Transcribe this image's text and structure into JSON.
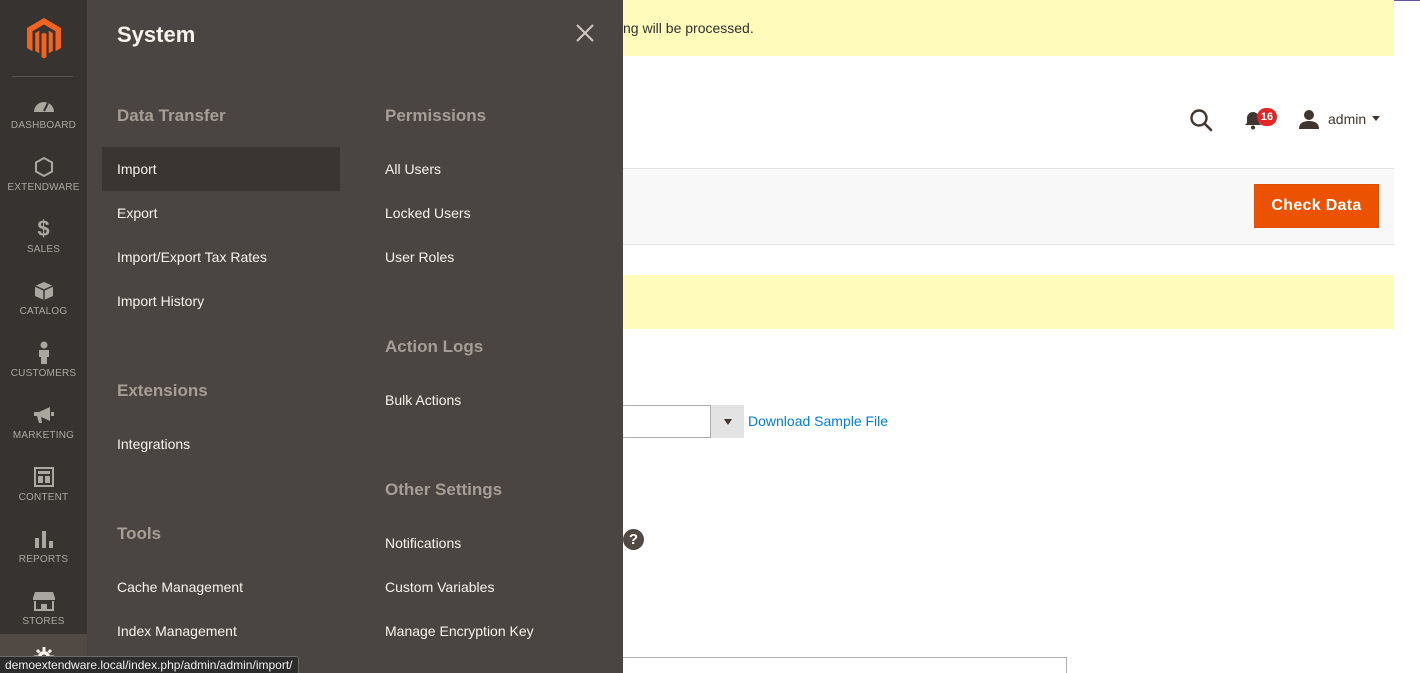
{
  "sidebar": {
    "logo": "magento-logo",
    "items": [
      {
        "label": "DASHBOARD",
        "icon": "dashboard-icon"
      },
      {
        "label": "EXTENDWARE",
        "icon": "hexagon-icon"
      },
      {
        "label": "SALES",
        "icon": "dollar-icon"
      },
      {
        "label": "CATALOG",
        "icon": "box-icon"
      },
      {
        "label": "CUSTOMERS",
        "icon": "person-icon"
      },
      {
        "label": "MARKETING",
        "icon": "megaphone-icon"
      },
      {
        "label": "CONTENT",
        "icon": "layout-icon"
      },
      {
        "label": "REPORTS",
        "icon": "bar-chart-icon"
      },
      {
        "label": "STORES",
        "icon": "storefront-icon"
      },
      {
        "label": "",
        "icon": "gear-icon"
      }
    ]
  },
  "page": {
    "message_top": "ng will be processed.",
    "notification_count": "16",
    "user_name": "admin",
    "check_button": "Check Data",
    "download_link": "Download Sample File",
    "help": "?"
  },
  "flyout": {
    "title": "System",
    "left_column": [
      {
        "title": "Data Transfer",
        "links": [
          "Import",
          "Export",
          "Import/Export Tax Rates",
          "Import History"
        ]
      },
      {
        "title": "Extensions",
        "links": [
          "Integrations"
        ]
      },
      {
        "title": "Tools",
        "links": [
          "Cache Management",
          "Index Management"
        ]
      }
    ],
    "right_column": [
      {
        "title": "Permissions",
        "links": [
          "All Users",
          "Locked Users",
          "User Roles"
        ]
      },
      {
        "title": "Action Logs",
        "links": [
          "Bulk Actions"
        ]
      },
      {
        "title": "Other Settings",
        "links": [
          "Notifications",
          "Custom Variables",
          "Manage Encryption Key"
        ]
      }
    ]
  },
  "status_url": "demoextendware.local/index.php/admin/admin/import/",
  "colors": {
    "accent": "#eb5202",
    "sidebar": "#373330",
    "flyout": "#4a4542",
    "message": "#fffbbb",
    "link": "#007bdb"
  }
}
